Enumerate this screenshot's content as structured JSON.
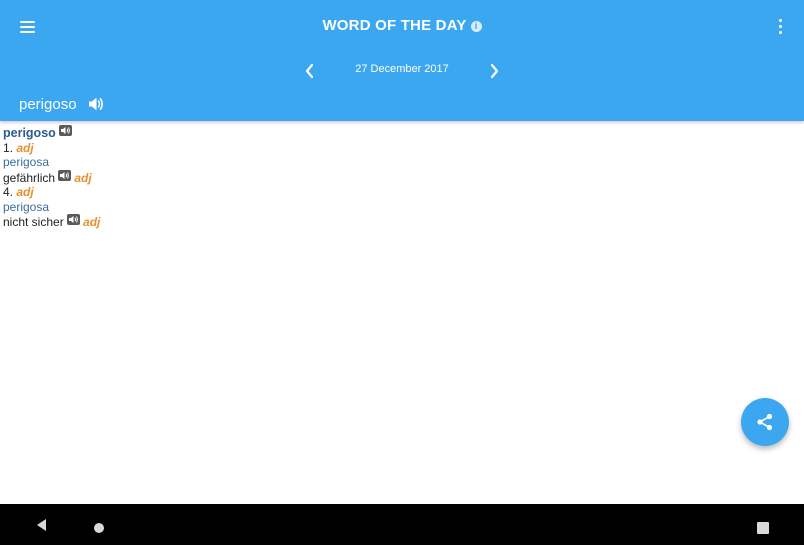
{
  "appbar": {
    "title": "WORD OF THE DAY",
    "date": "27 December 2017",
    "word": "perigoso",
    "background": "#3aa7f0",
    "icons": [
      "menu-icon",
      "info-icon",
      "more-vert-icon",
      "chevron-left-icon",
      "chevron-right-icon",
      "speaker-icon"
    ]
  },
  "entry": {
    "headword": "perigoso",
    "senses": [
      {
        "number": "1.",
        "pos": "adj",
        "translation_form": "perigosa",
        "meaning": "gefährlich",
        "meaning_pos": "adj"
      },
      {
        "number": "4.",
        "pos": "adj",
        "translation_form": "perigosa",
        "meaning": "nicht sicher",
        "meaning_pos": "adj"
      }
    ]
  },
  "fab": {
    "icon": "share-icon",
    "color": "#3aa7f0"
  },
  "system_nav": {
    "icons": [
      "back-icon",
      "home-icon",
      "recents-icon"
    ]
  },
  "colors": {
    "headword": "#2e5b8f",
    "pos": "#e8912d",
    "translation": "#3b6d9e"
  }
}
